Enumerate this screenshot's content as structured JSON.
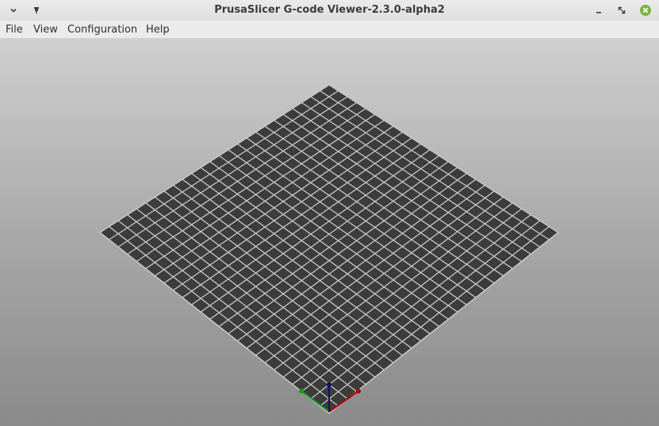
{
  "window": {
    "title": "PrusaSlicer G-code Viewer-2.3.0-alpha2"
  },
  "titlebar": {
    "left_icons": [
      "chevron-down-icon",
      "pin-icon"
    ],
    "right_icons": [
      "minimize-icon",
      "maximize-icon",
      "close-icon"
    ],
    "close_color": "#7cb342"
  },
  "menu": {
    "items": [
      {
        "label": "File"
      },
      {
        "label": "View"
      },
      {
        "label": "Configuration"
      },
      {
        "label": "Help"
      }
    ]
  },
  "scene": {
    "bed_color": "#3c3c3c",
    "grid_line_color": "#c8c8c8",
    "grid_divisions": 25,
    "axes": {
      "x_color": "#b00000",
      "y_color": "#1a9a1a",
      "z_color": "#10106a"
    }
  }
}
